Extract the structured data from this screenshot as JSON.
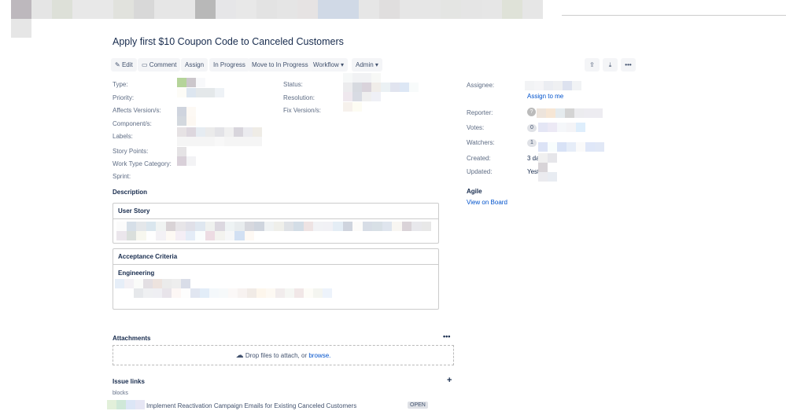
{
  "issue": {
    "title": "Apply first $10 Coupon Code to Canceled Customers"
  },
  "toolbar": {
    "edit": "Edit",
    "comment": "Comment",
    "assign": "Assign",
    "in_progress": "In Progress",
    "move_to_in_progress": "Move to In Progress",
    "workflow": "Workflow",
    "admin": "Admin"
  },
  "details": {
    "type": "Type:",
    "priority": "Priority:",
    "affects": "Affects Version/s:",
    "components": "Component/s:",
    "labels": "Labels:",
    "story_points": "Story Points:",
    "work_type": "Work Type Category:",
    "sprint": "Sprint:",
    "status": "Status:",
    "resolution": "Resolution:",
    "fix": "Fix Version/s:"
  },
  "people": {
    "assignee": "Assignee:",
    "assign_to_me": "Assign to me",
    "reporter": "Reporter:",
    "votes": "Votes:",
    "votes_count": "0",
    "watchers": "Watchers:",
    "watchers_count": "1"
  },
  "dates": {
    "created": "Created:",
    "created_value": "3 da",
    "updated": "Updated:",
    "updated_value": "Yeste"
  },
  "agile": {
    "title": "Agile",
    "view_on_board": "View on Board"
  },
  "description": {
    "title": "Description",
    "user_story": "User Story",
    "acceptance": "Acceptance Criteria",
    "engineering": "Engineering"
  },
  "attachments": {
    "title": "Attachments",
    "drop_text": "Drop files to attach, or",
    "browse": "browse."
  },
  "links": {
    "title": "Issue links",
    "type": "blocks",
    "item": "Implement Reactivation Campaign Emails for Existing Canceled Customers",
    "status": "OPEN"
  }
}
